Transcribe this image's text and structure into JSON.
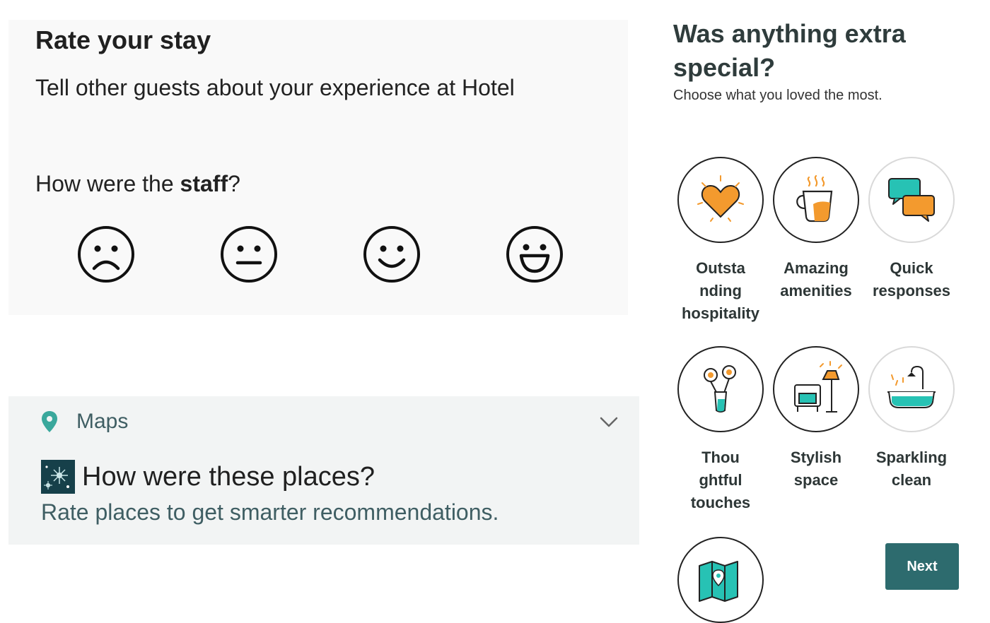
{
  "rate": {
    "title": "Rate your stay",
    "subtitle": "Tell other guests about your experience at Hotel",
    "question_prefix": "How were the ",
    "question_bold": "staff",
    "question_suffix": "?",
    "faces": [
      {
        "name": "sad-face",
        "icon": "sad-face-icon"
      },
      {
        "name": "neutral-face",
        "icon": "neutral-face-icon"
      },
      {
        "name": "smile-face",
        "icon": "smile-face-icon"
      },
      {
        "name": "grin-face",
        "icon": "grin-face-icon"
      }
    ]
  },
  "maps": {
    "app_name": "Maps",
    "headline": "How were these places?",
    "body": "Rate places to get smarter recommendations."
  },
  "special": {
    "title": "Was anything extra special?",
    "subtitle": "Choose what you loved the most.",
    "options": [
      {
        "label": "Outsta\nnding\nhospitality",
        "icon": "heart-icon"
      },
      {
        "label": "Amazing\namenities",
        "icon": "coffee-cup-icon"
      },
      {
        "label": "Quick\nresponses",
        "icon": "chat-bubbles-icon"
      },
      {
        "label": "Thou\nghtful\ntouches",
        "icon": "flower-vase-icon"
      },
      {
        "label": "Stylish\nspace",
        "icon": "armchair-lamp-icon"
      },
      {
        "label": "Sparkling\nclean",
        "icon": "bathtub-icon"
      },
      {
        "label": "",
        "icon": "map-icon"
      }
    ],
    "next_label": "Next"
  },
  "colors": {
    "accent_orange": "#f39a2e",
    "accent_teal": "#27c2b4",
    "button_teal": "#2d6b6e",
    "maps_text": "#3f5e63"
  }
}
